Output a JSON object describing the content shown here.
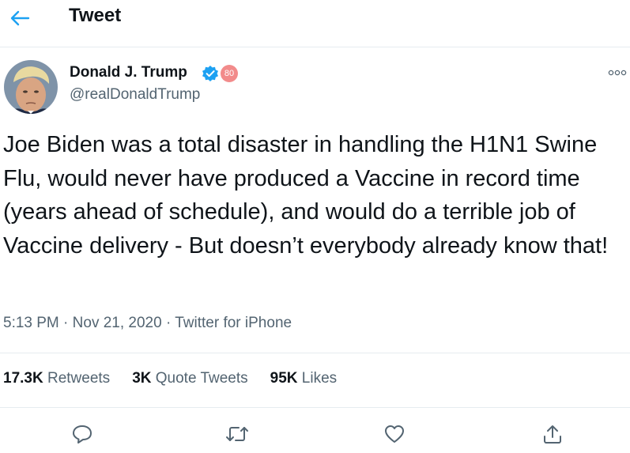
{
  "header": {
    "title": "Tweet",
    "back_icon": "arrow-left-icon"
  },
  "author": {
    "name": "Donald J. Trump",
    "handle": "@realDonaldTrump",
    "badge": "80",
    "verified_icon": "verified-icon"
  },
  "tweet": {
    "text": "Joe Biden was a total disaster in handling the H1N1 Swine Flu, would never have produced a Vaccine in record time (years ahead of schedule), and would do a terrible job of Vaccine delivery - But doesn’t everybody already know that!",
    "time": "5:13 PM",
    "date": "Nov 21, 2020",
    "source": "Twitter for iPhone",
    "separator": "·"
  },
  "stats": {
    "retweets_count": "17.3K",
    "retweets_label": "Retweets",
    "quotes_count": "3K",
    "quotes_label": "Quote Tweets",
    "likes_count": "95K",
    "likes_label": "Likes"
  },
  "actions": {
    "reply_icon": "reply-icon",
    "retweet_icon": "retweet-icon",
    "like_icon": "heart-icon",
    "share_icon": "share-icon"
  },
  "colors": {
    "accent": "#1da1f2",
    "text": "#0f1419",
    "secondary": "#536471",
    "divider": "#e6ecf0",
    "badge": "#f28b8b"
  }
}
